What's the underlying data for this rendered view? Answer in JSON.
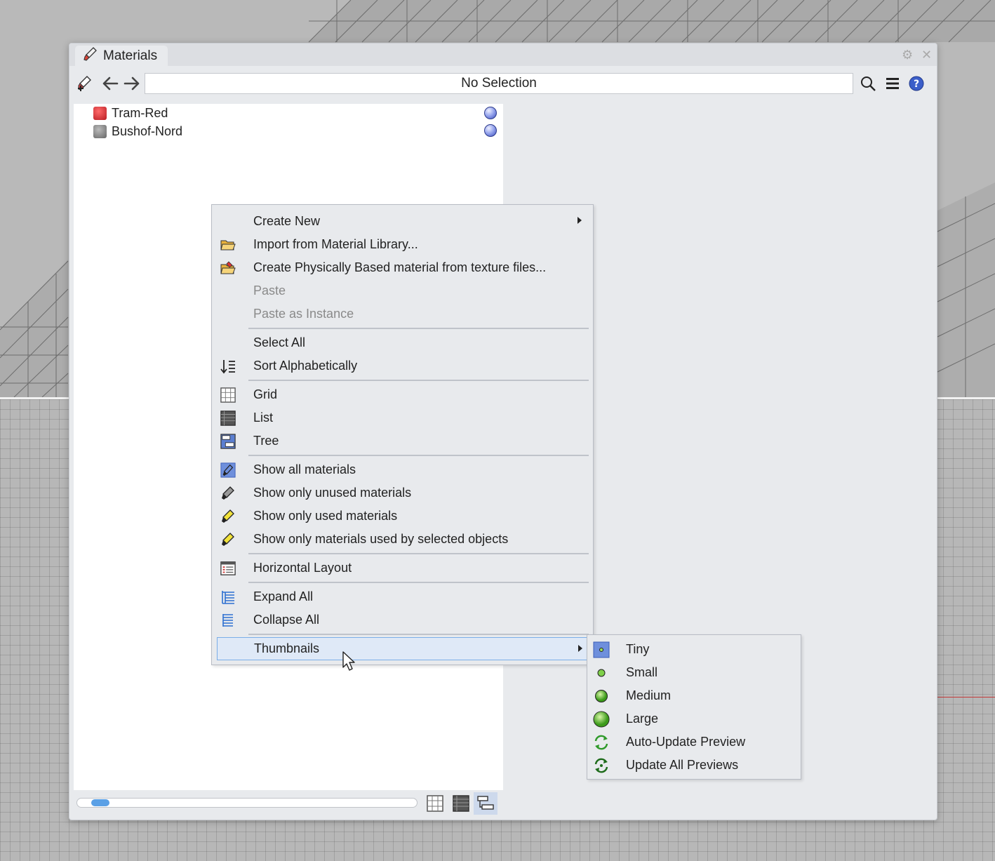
{
  "window": {
    "tab_title": "Materials",
    "tab_icon": "material-brush-icon",
    "colors": {
      "panel_bg": "#e8eaed",
      "list_bg": "#ffffff",
      "highlight": "#dfe9f7",
      "highlight_border": "#7aaee8",
      "disabled_text": "#8a8a8a"
    }
  },
  "toolbar": {
    "selection_text": "No Selection",
    "icons": [
      "add-material-icon",
      "back-arrow-icon",
      "forward-arrow-icon",
      "search-icon",
      "hamburger-menu-icon",
      "help-icon"
    ]
  },
  "materials": [
    {
      "name": "Tram-Red",
      "thumb_color": "#c0242a"
    },
    {
      "name": "Bushof-Nord",
      "thumb_color": "#7a7a7a"
    }
  ],
  "context_menu": {
    "items": [
      {
        "label": "Create New",
        "icon": "",
        "has_submenu": true
      },
      {
        "label": "Import from Material Library...",
        "icon": "folder-open-icon"
      },
      {
        "label": "Create Physically Based material from texture files...",
        "icon": "folder-texture-icon"
      },
      {
        "label": "Paste",
        "icon": "",
        "disabled": true
      },
      {
        "label": "Paste as Instance",
        "icon": "",
        "disabled": true
      },
      {
        "label": "Select All",
        "icon": ""
      },
      {
        "label": "Sort Alphabetically",
        "icon": "sort-icon"
      },
      {
        "label": "Grid",
        "icon": "grid-view-icon"
      },
      {
        "label": "List",
        "icon": "list-view-icon"
      },
      {
        "label": "Tree",
        "icon": "tree-view-icon"
      },
      {
        "label": "Show all materials",
        "icon": "show-all-materials-icon"
      },
      {
        "label": "Show only unused materials",
        "icon": "unused-materials-icon"
      },
      {
        "label": "Show only used materials",
        "icon": "used-materials-icon"
      },
      {
        "label": "Show only materials used by selected objects",
        "icon": "selected-materials-icon"
      },
      {
        "label": "Horizontal Layout",
        "icon": "horizontal-layout-icon"
      },
      {
        "label": "Expand All",
        "icon": "expand-all-icon"
      },
      {
        "label": "Collapse All",
        "icon": "collapse-all-icon"
      },
      {
        "label": "Thumbnails",
        "icon": "",
        "has_submenu": true,
        "highlighted": true
      }
    ]
  },
  "thumbnails_submenu": {
    "items": [
      {
        "label": "Tiny",
        "icon": "tiny-thumb-icon",
        "selected": true
      },
      {
        "label": "Small",
        "icon": "small-thumb-icon"
      },
      {
        "label": "Medium",
        "icon": "medium-thumb-icon"
      },
      {
        "label": "Large",
        "icon": "large-thumb-icon"
      },
      {
        "label": "Auto-Update Preview",
        "icon": "auto-update-icon"
      },
      {
        "label": "Update All Previews",
        "icon": "update-previews-icon"
      }
    ]
  },
  "bottom_bar": {
    "view_buttons": [
      "grid-view-icon",
      "list-view-icon",
      "tree-view-icon"
    ],
    "active_view": "tree"
  }
}
